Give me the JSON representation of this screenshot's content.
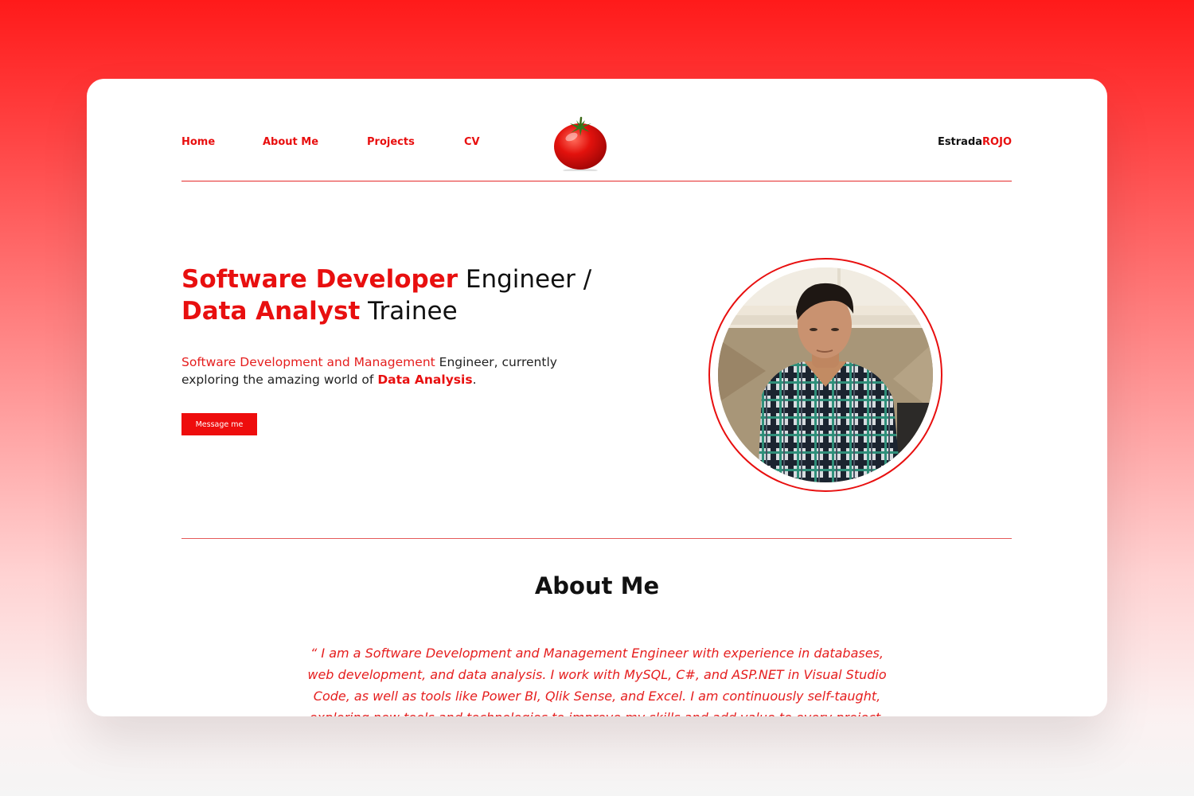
{
  "nav": {
    "items": [
      {
        "label": "Home"
      },
      {
        "label": "About Me"
      },
      {
        "label": "Projects"
      },
      {
        "label": "CV"
      }
    ],
    "brand_part1": "Estrada",
    "brand_part2": "ROJO",
    "logo_icon": "tomato-icon"
  },
  "hero": {
    "title_part1": "Software Developer",
    "title_part2": " Engineer /",
    "title_part3": "Data Analyst",
    "title_part4": " Trainee",
    "desc_part1": "Software Development and Management",
    "desc_part2": " Engineer, currently exploring the amazing world of ",
    "desc_part3": "Data Analysis",
    "desc_part4": ".",
    "button_label": "Message me"
  },
  "about": {
    "title": "About Me",
    "text": "“ I am a Software Development and Management Engineer with experience in databases, web development, and data analysis. I work with MySQL, C#, and ASP.NET in Visual Studio Code, as well as tools like Power BI, Qlik Sense, and Excel. I am continuously self-taught, exploring new tools and technologies to improve my skills and add value to every project."
  },
  "colors": {
    "accent": "#e80f0f",
    "text": "#111111",
    "background_top": "#ff1a1a"
  }
}
